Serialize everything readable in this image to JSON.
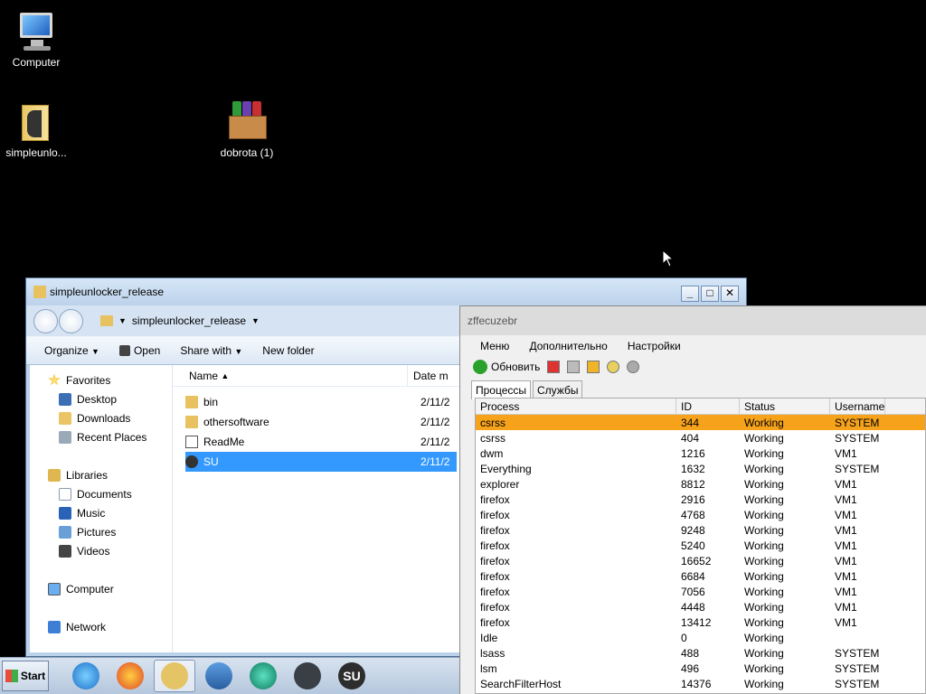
{
  "desktop": {
    "icons": [
      {
        "label": "Computer",
        "icon": "computer-icon"
      },
      {
        "label": "simpleunlo...",
        "icon": "folder-icon"
      },
      {
        "label": "dobrota (1)",
        "icon": "winrar-archive-icon"
      }
    ]
  },
  "explorer": {
    "title": "simpleunlocker_release",
    "address": "simpleunlocker_release",
    "toolbar": {
      "organize": "Organize",
      "open": "Open",
      "share_with": "Share with",
      "new_folder": "New folder"
    },
    "nav": {
      "favorites": "Favorites",
      "desktop": "Desktop",
      "downloads": "Downloads",
      "recent_places": "Recent Places",
      "libraries": "Libraries",
      "documents": "Documents",
      "music": "Music",
      "pictures": "Pictures",
      "videos": "Videos",
      "computer": "Computer",
      "network": "Network"
    },
    "columns": {
      "name": "Name",
      "date": "Date m"
    },
    "files": [
      {
        "name": "bin",
        "date": "2/11/2",
        "type": "folder"
      },
      {
        "name": "othersoftware",
        "date": "2/11/2",
        "type": "folder"
      },
      {
        "name": "ReadMe",
        "date": "2/11/2",
        "type": "document"
      },
      {
        "name": "SU",
        "date": "2/11/2",
        "type": "su-app",
        "selected": true
      }
    ]
  },
  "procwin": {
    "title": "zffecuzebr",
    "menu": [
      "Меню",
      "Дополнительно",
      "Настройки"
    ],
    "refresh_label": "Обновить",
    "tabs": [
      "Процессы",
      "Службы"
    ],
    "columns": {
      "process": "Process",
      "id": "ID",
      "status": "Status",
      "username": "Username"
    },
    "rows": [
      {
        "process": "csrss",
        "id": "344",
        "status": "Working",
        "user": "SYSTEM",
        "selected": true
      },
      {
        "process": "csrss",
        "id": "404",
        "status": "Working",
        "user": "SYSTEM"
      },
      {
        "process": "dwm",
        "id": "1216",
        "status": "Working",
        "user": "VM1"
      },
      {
        "process": "Everything",
        "id": "1632",
        "status": "Working",
        "user": "SYSTEM"
      },
      {
        "process": "explorer",
        "id": "8812",
        "status": "Working",
        "user": "VM1"
      },
      {
        "process": "firefox",
        "id": "2916",
        "status": "Working",
        "user": "VM1"
      },
      {
        "process": "firefox",
        "id": "4768",
        "status": "Working",
        "user": "VM1"
      },
      {
        "process": "firefox",
        "id": "9248",
        "status": "Working",
        "user": "VM1"
      },
      {
        "process": "firefox",
        "id": "5240",
        "status": "Working",
        "user": "VM1"
      },
      {
        "process": "firefox",
        "id": "16652",
        "status": "Working",
        "user": "VM1"
      },
      {
        "process": "firefox",
        "id": "6684",
        "status": "Working",
        "user": "VM1"
      },
      {
        "process": "firefox",
        "id": "7056",
        "status": "Working",
        "user": "VM1"
      },
      {
        "process": "firefox",
        "id": "4448",
        "status": "Working",
        "user": "VM1"
      },
      {
        "process": "firefox",
        "id": "13412",
        "status": "Working",
        "user": "VM1"
      },
      {
        "process": "Idle",
        "id": "0",
        "status": "Working",
        "user": ""
      },
      {
        "process": "lsass",
        "id": "488",
        "status": "Working",
        "user": "SYSTEM"
      },
      {
        "process": "lsm",
        "id": "496",
        "status": "Working",
        "user": "SYSTEM"
      },
      {
        "process": "SearchFilterHost",
        "id": "14376",
        "status": "Working",
        "user": "SYSTEM"
      }
    ]
  },
  "taskbar": {
    "start_label": "Start",
    "su_label": "SU",
    "items": [
      "internet-explorer-icon",
      "firefox-icon",
      "explorer-icon",
      "media-player-icon",
      "globe-app-icon",
      "task-manager-icon",
      "su-icon"
    ]
  },
  "colors": {
    "selected_row": "#f7a21b",
    "selected_file": "#3399ff",
    "desktop_bg": "#000000"
  }
}
